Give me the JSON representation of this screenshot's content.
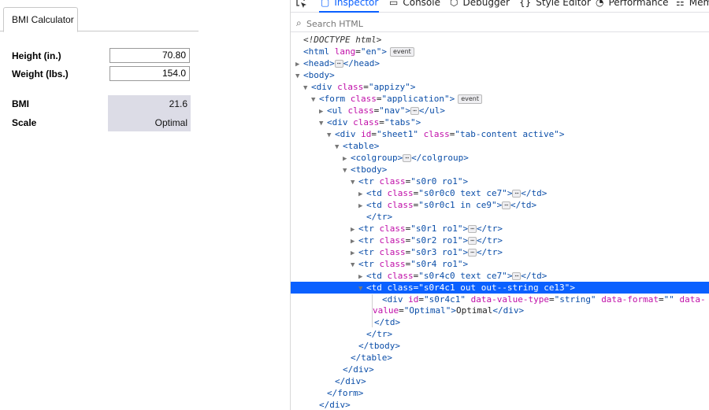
{
  "app": {
    "tab_label": "BMI Calculator",
    "height_label": "Height (in.)",
    "height_value": "70.80",
    "weight_label": "Weight (lbs.)",
    "weight_value": "154.0",
    "bmi_label": "BMI",
    "bmi_value": "21.6",
    "scale_label": "Scale",
    "scale_value": "Optimal"
  },
  "devtools": {
    "tabs": [
      {
        "label": "Inspector",
        "icon": "inspector-icon"
      },
      {
        "label": "Console",
        "icon": "console-icon"
      },
      {
        "label": "Debugger",
        "icon": "debugger-icon"
      },
      {
        "label": "Style Editor",
        "icon": "style-editor-icon"
      },
      {
        "label": "Performance",
        "icon": "performance-icon"
      },
      {
        "label": "Mem",
        "icon": "memory-icon"
      }
    ],
    "search_placeholder": "Search HTML",
    "badges": {
      "event": "event",
      "ellipsis": "⋯"
    },
    "lines": [
      {
        "pre": "",
        "tw": "",
        "html": "&lt;!DOCTYPE html&gt;"
      },
      {
        "tag": "html"
      },
      {
        "tag": "head"
      },
      {
        "tag": "body"
      },
      {
        "tag": "div.appizy"
      },
      {
        "tag": "form.application"
      },
      {
        "tag": "ul.nav"
      },
      {
        "tag": "div.tabs"
      },
      {
        "tag": "div#sheet1"
      },
      {
        "tag": "table"
      },
      {
        "tag": "colgroup"
      },
      {
        "tag": "tbody"
      },
      {
        "tag": "tr.s0r0"
      },
      {
        "tag": "td.s0r0c0"
      },
      {
        "tag": "td.s0r0c1"
      },
      {
        "tag": "/tr"
      },
      {
        "tag": "tr.s0r1"
      },
      {
        "tag": "tr.s0r2"
      },
      {
        "tag": "tr.s0r3"
      },
      {
        "tag": "tr.s0r4"
      },
      {
        "tag": "td.s0r4c0"
      },
      {
        "tag": "td.s0r4c1",
        "selected": true
      },
      {
        "tag": "div#s0r4c1"
      },
      {
        "tag": "/td"
      },
      {
        "tag": "/tr"
      },
      {
        "tag": "/tbody"
      },
      {
        "tag": "/table"
      },
      {
        "tag": "/div"
      },
      {
        "tag": "/div"
      },
      {
        "tag": "/form"
      },
      {
        "tag": "/div"
      }
    ]
  }
}
